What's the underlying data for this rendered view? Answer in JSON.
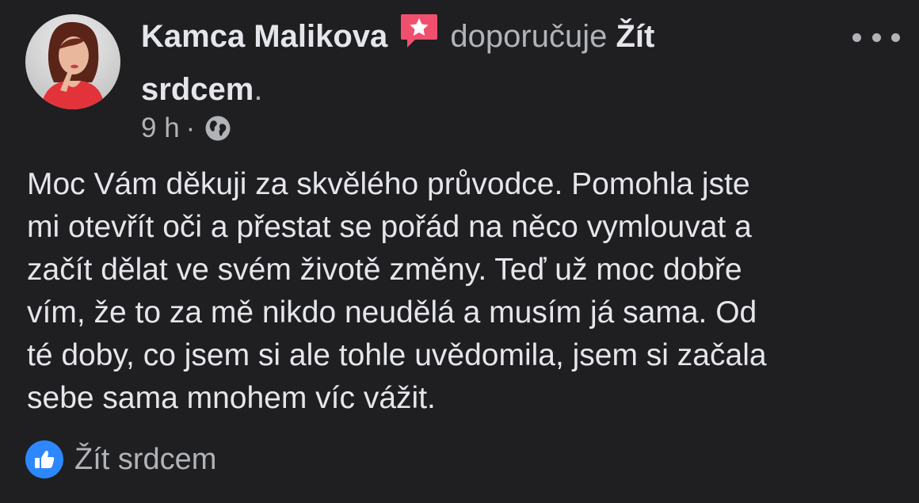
{
  "post": {
    "author": {
      "name": "Kamca Malikova",
      "avatar_icon": "profile-photo-woman-red-top"
    },
    "recommend_badge_icon": "recommendation-star-badge",
    "action_text": "doporučuje",
    "page_name": "Žít srdcem",
    "page_suffix": ".",
    "time": "9 h",
    "separator": "·",
    "privacy_icon": "globe-icon",
    "body_text": "Moc Vám děkuji za skvělého průvodce. Pomohla jste\nmi otevřít oči a přestat se pořád na něco vymlouvat a\nzačít dělat ve svém životě změny. Teď už moc dobře\nvím, že to za mě nikdo neudělá a musím já sama. Od\nté doby, co jsem si ale tohle uvědomila, jsem si začala\nsebe sama mnohem víc vážit.",
    "more_icon": "more-horizontal-icon",
    "reactions": {
      "icon": "like-icon",
      "label": "Žít srdcem"
    }
  },
  "colors": {
    "background": "#1f1f21",
    "primary_text": "#e4e6eb",
    "secondary_text": "#b0b3b8",
    "badge_red": "#f0506e",
    "like_blue": "#2d88ff"
  }
}
